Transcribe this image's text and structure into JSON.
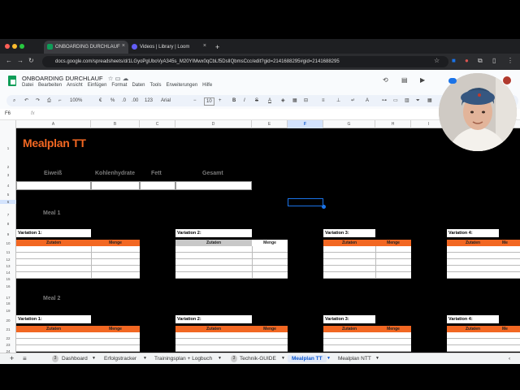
{
  "browser": {
    "tabs": [
      {
        "label": "ONBOARDING DURCHLAUF"
      },
      {
        "label": "Videos | Library | Loom"
      }
    ],
    "new_tab": "+",
    "url": "docs.google.com/spreadsheets/d/1LGyoPgUboVyA345s_M20YIMwx0qCbLf5DslIQbmsCcc/edit?gid=2141688295#gid=2141688295"
  },
  "sheets": {
    "doc_title": "ONBOARDING DURCHLAUF",
    "menus": [
      "Datei",
      "Bearbeiten",
      "Ansicht",
      "Einfügen",
      "Format",
      "Daten",
      "Tools",
      "Erweiterungen",
      "Hilfe"
    ],
    "toolbar": {
      "zoom": "100%",
      "currency": "€",
      "percent": "%",
      "decimals_less": ".0",
      "decimals_more": ".00",
      "number_format": "123",
      "font": "Arial",
      "font_size": "10",
      "bold": "B",
      "italic": "I",
      "strike": "S",
      "text_color": "A"
    },
    "name_box": "F6",
    "fx": "fx",
    "columns": [
      "A",
      "B",
      "C",
      "D",
      "E",
      "F",
      "G",
      "H",
      "I"
    ],
    "rows": [
      "1",
      "2",
      "3",
      "4",
      "5",
      "6",
      "7",
      "8",
      "9",
      "10",
      "11",
      "12",
      "13",
      "14",
      "15",
      "16",
      "17",
      "18",
      "19",
      "20",
      "21",
      "22",
      "23",
      "24"
    ],
    "content": {
      "title": "Mealplan TT",
      "headers": [
        "Eiweiß",
        "Kohlenhydrate",
        "Fett",
        "Gesamt"
      ],
      "meal1": "Meal 1",
      "meal2": "Meal 2",
      "variations": [
        "Variation 1:",
        "Variation 2:",
        "Variation 3:",
        "Variation 4:"
      ],
      "zutaten": "Zutaten",
      "menge": "Menge",
      "menge_cut": "Me"
    },
    "sheet_tabs": [
      "Dashboard",
      "Erfolgstracker",
      "Trainingsplan + Logbuch",
      "Technik-GUIDE",
      "Mealplan TT",
      "Mealplan NTT"
    ],
    "sheet_tab_badges": [
      "3",
      "3"
    ],
    "add_sheet": "+",
    "all_sheets": "≡"
  },
  "colors": {
    "accent_orange": "#f26722",
    "selection_blue": "#1a73e8",
    "sheets_green": "#0f9d58"
  }
}
